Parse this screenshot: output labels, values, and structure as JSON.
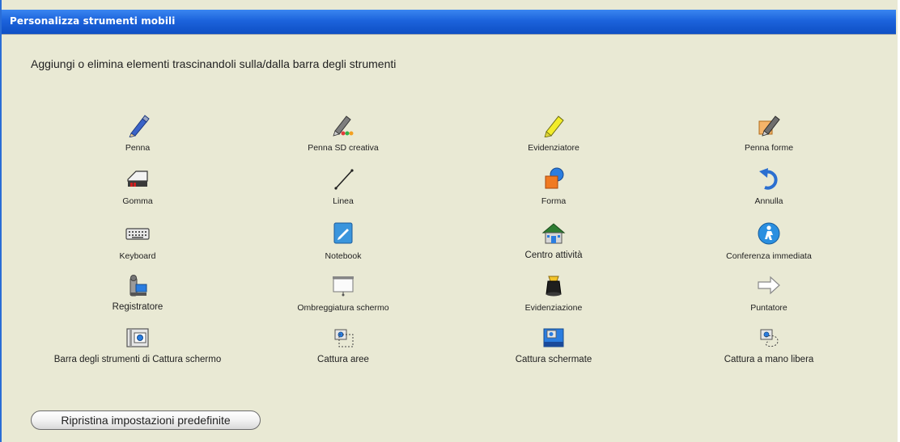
{
  "window": {
    "title": "Personalizza strumenti mobili"
  },
  "instructions": "Aggiungi o elimina elementi trascinandoli sulla/dalla barra degli strumenti",
  "tools": [
    {
      "label": "Penna",
      "icon": "pen-icon"
    },
    {
      "label": "Penna SD creativa",
      "icon": "creative-pen-icon"
    },
    {
      "label": "Evidenziatore",
      "icon": "highlighter-icon"
    },
    {
      "label": "Penna forme",
      "icon": "shape-pen-icon"
    },
    {
      "label": "Gomma",
      "icon": "eraser-icon"
    },
    {
      "label": "Linea",
      "icon": "line-icon"
    },
    {
      "label": "Forma",
      "icon": "shape-icon"
    },
    {
      "label": "Annulla",
      "icon": "undo-icon"
    },
    {
      "label": "Keyboard",
      "icon": "keyboard-icon"
    },
    {
      "label": "Notebook",
      "icon": "notebook-icon"
    },
    {
      "label": "Centro attività",
      "icon": "activity-center-icon"
    },
    {
      "label": "Conferenza immediata",
      "icon": "instant-conference-icon"
    },
    {
      "label": "Registratore",
      "icon": "recorder-icon"
    },
    {
      "label": "Ombreggiatura schermo",
      "icon": "screen-shade-icon"
    },
    {
      "label": "Evidenziazione",
      "icon": "spotlight-icon"
    },
    {
      "label": "Puntatore",
      "icon": "pointer-arrow-icon"
    },
    {
      "label": "Barra degli strumenti di Cattura schermo",
      "icon": "screen-capture-toolbar-icon"
    },
    {
      "label": "Cattura aree",
      "icon": "area-capture-icon"
    },
    {
      "label": "Cattura schermate",
      "icon": "screen-capture-icon"
    },
    {
      "label": "Cattura a mano libera",
      "icon": "freehand-capture-icon"
    }
  ],
  "reset_button": {
    "label": "Ripristina impostazioni predefinite"
  },
  "colors": {
    "title_bar": "#1c63dc",
    "dialog_background": "#e9e9d4"
  }
}
